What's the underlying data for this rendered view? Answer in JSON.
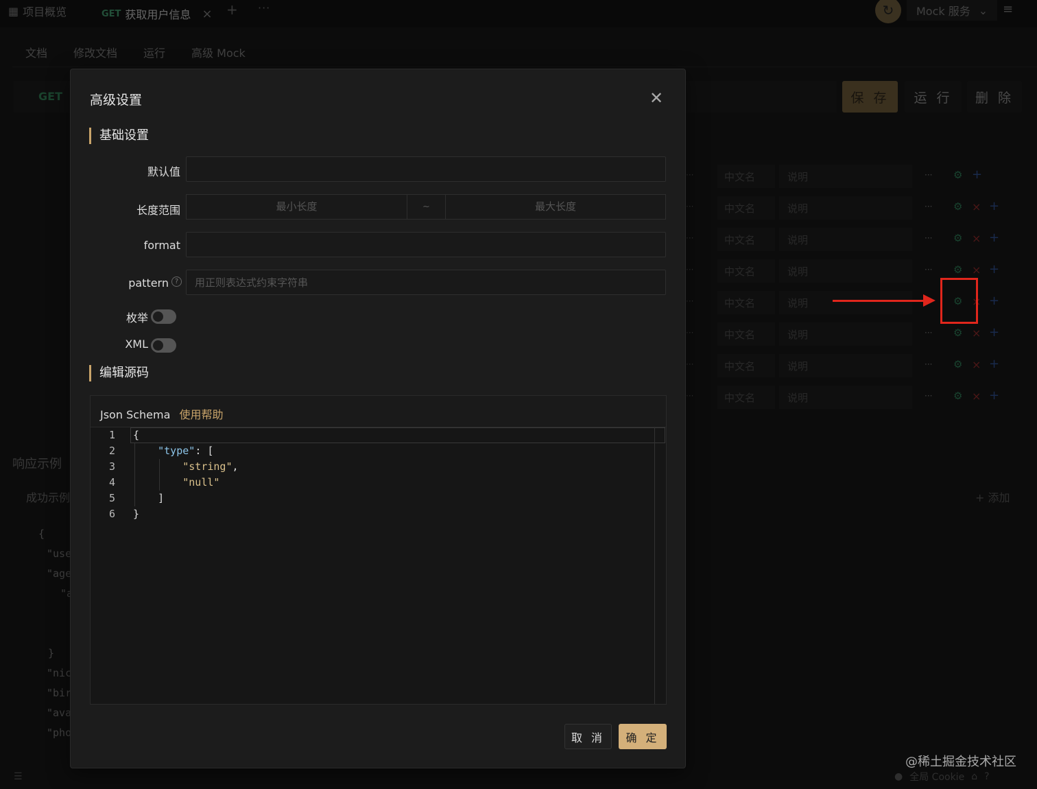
{
  "topbar": {
    "overview_label": "项目概览",
    "active_tab_method": "GET",
    "active_tab_title": "获取用户信息",
    "mock_service": "Mock 服务"
  },
  "subtabs": [
    "文档",
    "修改文档",
    "运行",
    "高级 Mock"
  ],
  "request": {
    "method": "GET",
    "save": "保 存",
    "run": "运 行",
    "delete": "删 除"
  },
  "schema_rows": {
    "cn_placeholder": "中文名",
    "desc_placeholder": "说明"
  },
  "response": {
    "title": "响应示例",
    "tab": "成功示例",
    "add": "+ 添加",
    "json_lines": [
      "{",
      "\"use",
      "\"age",
      "\"a",
      "}",
      "\"nic",
      "\"birt",
      "\"ava",
      "\"pho",
      "}"
    ]
  },
  "footer": {
    "cookie": "全局 Cookie",
    "watermark": "@稀土掘金技术社区"
  },
  "modal": {
    "title": "高级设置",
    "section_basic": "基础设置",
    "default_label": "默认值",
    "length_label": "长度范围",
    "min_placeholder": "最小长度",
    "range_sep": "~",
    "max_placeholder": "最大长度",
    "format_label": "format",
    "pattern_label": "pattern",
    "pattern_placeholder": "用正则表达式约束字符串",
    "enum_label": "枚举",
    "xml_label": "XML",
    "section_source": "编辑源码",
    "editor_title": "Json Schema",
    "editor_help": "使用帮助",
    "cancel": "取 消",
    "ok": "确 定"
  },
  "colors": {
    "accent": "#c9a46a",
    "ok_button": "#d4b07a",
    "get_method": "#3f8f66",
    "annotation": "#e0261c"
  }
}
